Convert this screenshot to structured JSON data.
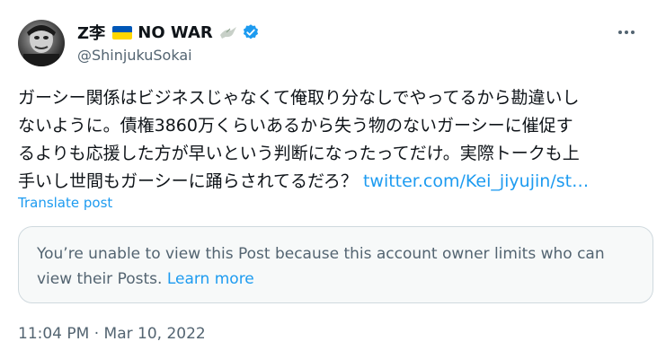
{
  "author": {
    "display_name": "Z李",
    "no_war": "NO WAR",
    "handle": "@ShinjukuSokai"
  },
  "post": {
    "text_lines": [
      "ガーシー関係はビジネスじゃなくて俺取り分なしでやってるから勘違いし",
      "ないように。債権3860万くらいあるから失う物のないガーシーに催促す",
      "るよりも応援した方が早いという判断になったってだけ。実際トークも上",
      "手いし世間もガーシーに踊らされてるだろ？ "
    ],
    "link": "twitter.com/Kei_jiyujin/st…",
    "translate": "Translate post"
  },
  "notice": {
    "message": "You’re unable to view this Post because this account owner limits who can view their Posts.",
    "learn_more": "Learn more"
  },
  "timestamp": "11:04 PM · Mar 10, 2022",
  "colors": {
    "link": "#1d9bf0",
    "muted": "#536471",
    "flag_blue": "#0057b7",
    "flag_yellow": "#ffd700"
  },
  "icons": {
    "more": "more-icon",
    "verified": "verified-badge-icon",
    "dove": "dove-icon",
    "flag": "ukraine-flag-icon"
  }
}
